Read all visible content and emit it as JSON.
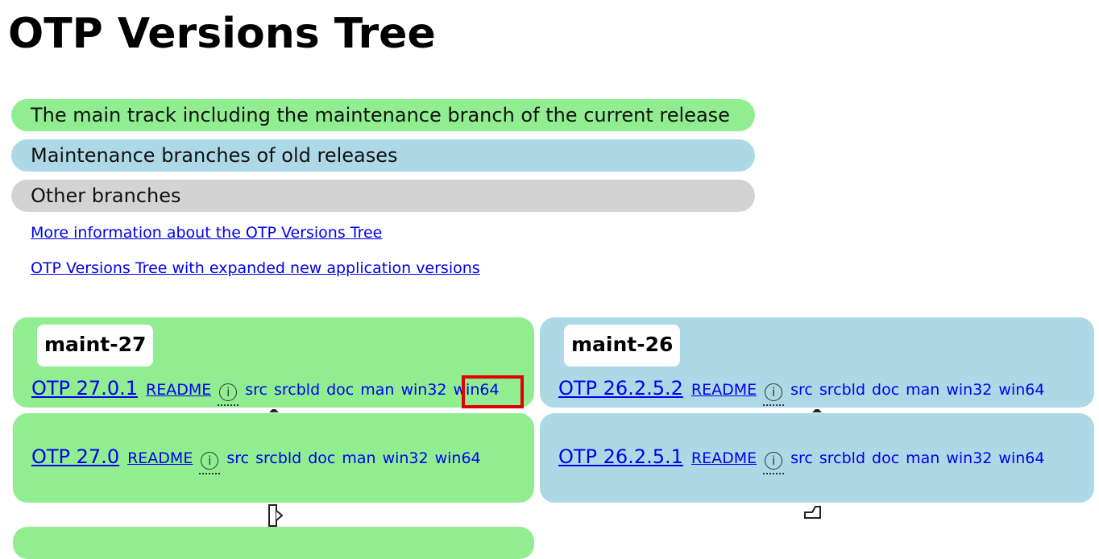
{
  "page": {
    "title": "OTP Versions Tree"
  },
  "legend": {
    "main": "The main track including the maintenance branch of the current release",
    "maint": "Maintenance branches of old releases",
    "other": "Other branches"
  },
  "links": {
    "more_info": "More information about the OTP Versions Tree",
    "expanded": "OTP Versions Tree with expanded new application versions"
  },
  "tree": {
    "left": {
      "branch": "maint-27",
      "releases": [
        {
          "version": "OTP 27.0.1",
          "readme": "README",
          "info": "i",
          "packages": [
            "src",
            "srcbld",
            "doc",
            "man",
            "win32",
            "win64"
          ]
        },
        {
          "version": "OTP 27.0",
          "readme": "README",
          "info": "i",
          "packages": [
            "src",
            "srcbld",
            "doc",
            "man",
            "win32",
            "win64"
          ]
        }
      ]
    },
    "right": {
      "branch": "maint-26",
      "releases": [
        {
          "version": "OTP 26.2.5.2",
          "readme": "README",
          "info": "i",
          "packages": [
            "src",
            "srcbld",
            "doc",
            "man",
            "win32",
            "win64"
          ]
        },
        {
          "version": "OTP 26.2.5.1",
          "readme": "README",
          "info": "i",
          "packages": [
            "src",
            "srcbld",
            "doc",
            "man",
            "win32",
            "win64"
          ]
        }
      ]
    }
  },
  "colors": {
    "main": "#90ee90",
    "maint": "#add8e6",
    "other": "#d3d3d3",
    "highlight": "#e00000"
  }
}
